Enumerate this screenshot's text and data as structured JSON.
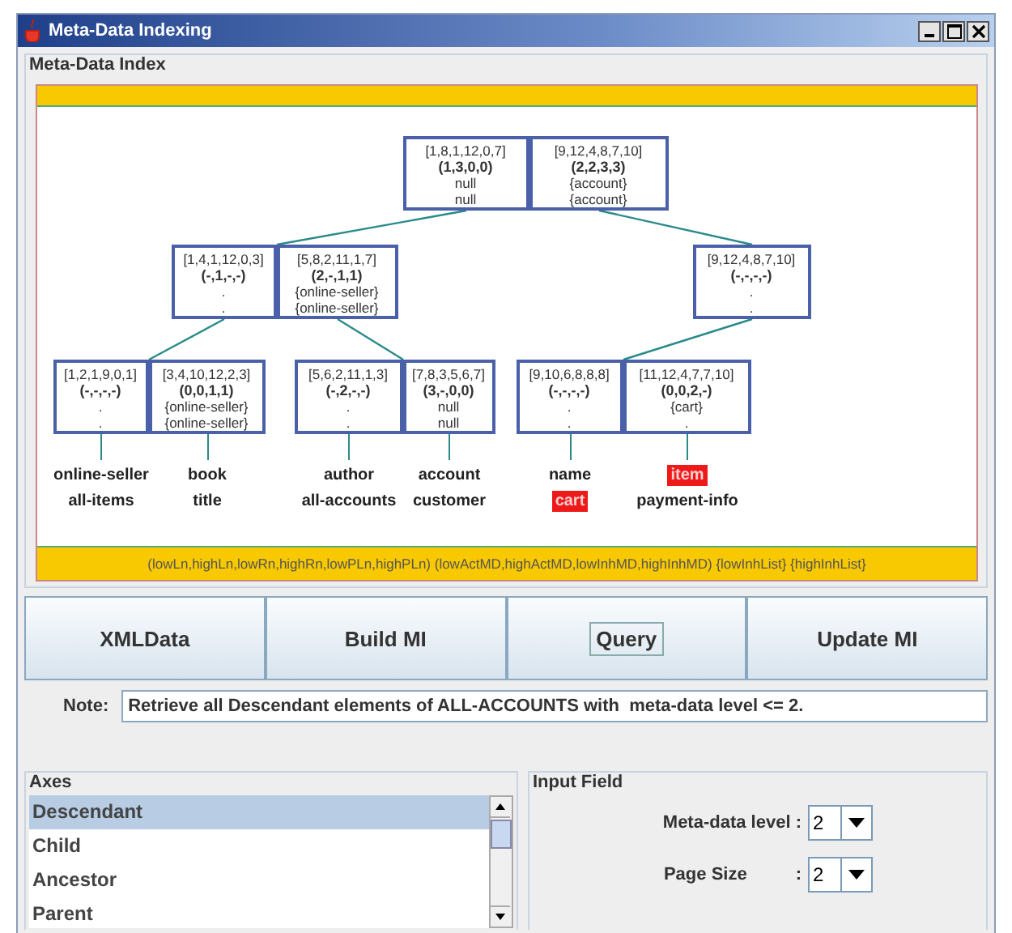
{
  "window": {
    "title": "Meta-Data Indexing"
  },
  "index_panel": {
    "title": "Meta-Data Index",
    "tree": {
      "cells": [
        {
          "range": "[1,8,1,12,0,7]",
          "md": "(1,3,0,0)",
          "lines": [
            "null",
            "null"
          ]
        },
        {
          "range": "[9,12,4,8,7,10]",
          "md": "(2,2,3,3)",
          "lines": [
            "{account}",
            "{account}"
          ]
        }
      ],
      "children": [
        {
          "cells": [
            {
              "range": "[1,4,1,12,0,3]",
              "md": "(-,1,-,-)",
              "lines": [
                ".",
                "."
              ]
            },
            {
              "range": "[5,8,2,11,1,7]",
              "md": "(2,-,1,1)",
              "lines": [
                "{online-seller}",
                "{online-seller}"
              ]
            }
          ],
          "children": [
            {
              "cells": [
                {
                  "range": "[1,2,1,9,0,1]",
                  "md": "(-,-,-,-)",
                  "lines": [
                    ".",
                    "."
                  ],
                  "labels": [
                    {
                      "text": "online-seller",
                      "highlighted": false
                    },
                    {
                      "text": "all-items",
                      "highlighted": false
                    }
                  ]
                },
                {
                  "range": "[3,4,10,12,2,3]",
                  "md": "(0,0,1,1)",
                  "lines": [
                    "{online-seller}",
                    "{online-seller}"
                  ],
                  "labels": [
                    {
                      "text": "book",
                      "highlighted": false
                    },
                    {
                      "text": "title",
                      "highlighted": false
                    }
                  ]
                }
              ]
            },
            {
              "cells": [
                {
                  "range": "[5,6,2,11,1,3]",
                  "md": "(-,2,-,-)",
                  "lines": [
                    ".",
                    "."
                  ],
                  "labels": [
                    {
                      "text": "author",
                      "highlighted": false
                    },
                    {
                      "text": "all-accounts",
                      "highlighted": false
                    }
                  ]
                },
                {
                  "range": "[7,8,3,5,6,7]",
                  "md": "(3,-,0,0)",
                  "lines": [
                    "null",
                    "null"
                  ],
                  "labels": [
                    {
                      "text": "account",
                      "highlighted": false
                    },
                    {
                      "text": "customer",
                      "highlighted": false
                    }
                  ]
                }
              ]
            }
          ]
        },
        {
          "cells": [
            {
              "range": "[9,12,4,8,7,10]",
              "md": "(-,-,-,-)",
              "lines": [
                ".",
                "."
              ]
            }
          ],
          "children": [
            {
              "cells": [
                {
                  "range": "[9,10,6,8,8,8]",
                  "md": "(-,-,-,-)",
                  "lines": [
                    ".",
                    "."
                  ],
                  "labels": [
                    {
                      "text": "name",
                      "highlighted": false
                    },
                    {
                      "text": "cart",
                      "highlighted": true
                    }
                  ]
                },
                {
                  "range": "[11,12,4,7,7,10]",
                  "md": "(0,0,2,-)",
                  "lines": [
                    "{cart}",
                    "."
                  ],
                  "labels": [
                    {
                      "text": "item",
                      "highlighted": true
                    },
                    {
                      "text": "payment-info",
                      "highlighted": false
                    }
                  ]
                }
              ]
            }
          ]
        }
      ]
    },
    "legend": "(lowLn,highLn,lowRn,highRn,lowPLn,highPLn) (lowActMD,highActMD,lowInhMD,highInhMD) {lowInhList} {highInhList}"
  },
  "buttons": [
    {
      "label": "XMLData",
      "focused": false
    },
    {
      "label": "Build MI",
      "focused": false
    },
    {
      "label": "Query",
      "focused": true
    },
    {
      "label": "Update MI",
      "focused": false
    }
  ],
  "note": {
    "label": "Note:",
    "value": "Retrieve all Descendant elements of ALL-ACCOUNTS with  meta-data level <= 2."
  },
  "axes": {
    "title": "Axes",
    "items": [
      {
        "label": "Descendant",
        "selected": true
      },
      {
        "label": "Child",
        "selected": false
      },
      {
        "label": "Ancestor",
        "selected": false
      },
      {
        "label": "Parent",
        "selected": false
      }
    ]
  },
  "input_field": {
    "title": "Input Field",
    "rows": [
      {
        "label": "Meta-data level :",
        "value": "2"
      },
      {
        "label": "Page Size",
        "separator": ":",
        "value": "2"
      }
    ]
  }
}
